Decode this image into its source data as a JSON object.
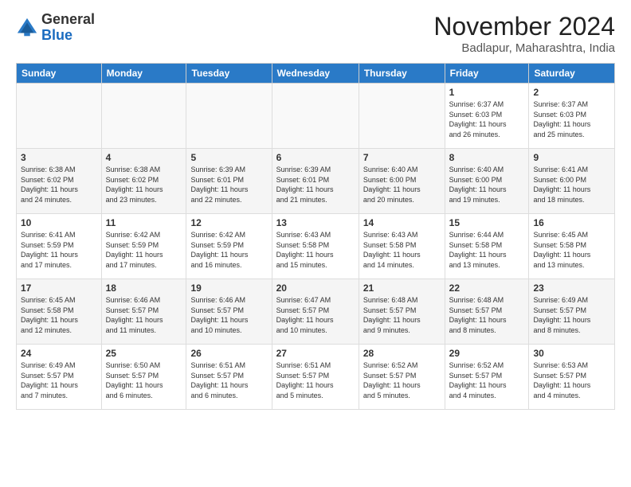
{
  "logo": {
    "general": "General",
    "blue": "Blue"
  },
  "header": {
    "month": "November 2024",
    "location": "Badlapur, Maharashtra, India"
  },
  "weekdays": [
    "Sunday",
    "Monday",
    "Tuesday",
    "Wednesday",
    "Thursday",
    "Friday",
    "Saturday"
  ],
  "weeks": [
    [
      {
        "day": "",
        "info": ""
      },
      {
        "day": "",
        "info": ""
      },
      {
        "day": "",
        "info": ""
      },
      {
        "day": "",
        "info": ""
      },
      {
        "day": "",
        "info": ""
      },
      {
        "day": "1",
        "info": "Sunrise: 6:37 AM\nSunset: 6:03 PM\nDaylight: 11 hours\nand 26 minutes."
      },
      {
        "day": "2",
        "info": "Sunrise: 6:37 AM\nSunset: 6:03 PM\nDaylight: 11 hours\nand 25 minutes."
      }
    ],
    [
      {
        "day": "3",
        "info": "Sunrise: 6:38 AM\nSunset: 6:02 PM\nDaylight: 11 hours\nand 24 minutes."
      },
      {
        "day": "4",
        "info": "Sunrise: 6:38 AM\nSunset: 6:02 PM\nDaylight: 11 hours\nand 23 minutes."
      },
      {
        "day": "5",
        "info": "Sunrise: 6:39 AM\nSunset: 6:01 PM\nDaylight: 11 hours\nand 22 minutes."
      },
      {
        "day": "6",
        "info": "Sunrise: 6:39 AM\nSunset: 6:01 PM\nDaylight: 11 hours\nand 21 minutes."
      },
      {
        "day": "7",
        "info": "Sunrise: 6:40 AM\nSunset: 6:00 PM\nDaylight: 11 hours\nand 20 minutes."
      },
      {
        "day": "8",
        "info": "Sunrise: 6:40 AM\nSunset: 6:00 PM\nDaylight: 11 hours\nand 19 minutes."
      },
      {
        "day": "9",
        "info": "Sunrise: 6:41 AM\nSunset: 6:00 PM\nDaylight: 11 hours\nand 18 minutes."
      }
    ],
    [
      {
        "day": "10",
        "info": "Sunrise: 6:41 AM\nSunset: 5:59 PM\nDaylight: 11 hours\nand 17 minutes."
      },
      {
        "day": "11",
        "info": "Sunrise: 6:42 AM\nSunset: 5:59 PM\nDaylight: 11 hours\nand 17 minutes."
      },
      {
        "day": "12",
        "info": "Sunrise: 6:42 AM\nSunset: 5:59 PM\nDaylight: 11 hours\nand 16 minutes."
      },
      {
        "day": "13",
        "info": "Sunrise: 6:43 AM\nSunset: 5:58 PM\nDaylight: 11 hours\nand 15 minutes."
      },
      {
        "day": "14",
        "info": "Sunrise: 6:43 AM\nSunset: 5:58 PM\nDaylight: 11 hours\nand 14 minutes."
      },
      {
        "day": "15",
        "info": "Sunrise: 6:44 AM\nSunset: 5:58 PM\nDaylight: 11 hours\nand 13 minutes."
      },
      {
        "day": "16",
        "info": "Sunrise: 6:45 AM\nSunset: 5:58 PM\nDaylight: 11 hours\nand 13 minutes."
      }
    ],
    [
      {
        "day": "17",
        "info": "Sunrise: 6:45 AM\nSunset: 5:58 PM\nDaylight: 11 hours\nand 12 minutes."
      },
      {
        "day": "18",
        "info": "Sunrise: 6:46 AM\nSunset: 5:57 PM\nDaylight: 11 hours\nand 11 minutes."
      },
      {
        "day": "19",
        "info": "Sunrise: 6:46 AM\nSunset: 5:57 PM\nDaylight: 11 hours\nand 10 minutes."
      },
      {
        "day": "20",
        "info": "Sunrise: 6:47 AM\nSunset: 5:57 PM\nDaylight: 11 hours\nand 10 minutes."
      },
      {
        "day": "21",
        "info": "Sunrise: 6:48 AM\nSunset: 5:57 PM\nDaylight: 11 hours\nand 9 minutes."
      },
      {
        "day": "22",
        "info": "Sunrise: 6:48 AM\nSunset: 5:57 PM\nDaylight: 11 hours\nand 8 minutes."
      },
      {
        "day": "23",
        "info": "Sunrise: 6:49 AM\nSunset: 5:57 PM\nDaylight: 11 hours\nand 8 minutes."
      }
    ],
    [
      {
        "day": "24",
        "info": "Sunrise: 6:49 AM\nSunset: 5:57 PM\nDaylight: 11 hours\nand 7 minutes."
      },
      {
        "day": "25",
        "info": "Sunrise: 6:50 AM\nSunset: 5:57 PM\nDaylight: 11 hours\nand 6 minutes."
      },
      {
        "day": "26",
        "info": "Sunrise: 6:51 AM\nSunset: 5:57 PM\nDaylight: 11 hours\nand 6 minutes."
      },
      {
        "day": "27",
        "info": "Sunrise: 6:51 AM\nSunset: 5:57 PM\nDaylight: 11 hours\nand 5 minutes."
      },
      {
        "day": "28",
        "info": "Sunrise: 6:52 AM\nSunset: 5:57 PM\nDaylight: 11 hours\nand 5 minutes."
      },
      {
        "day": "29",
        "info": "Sunrise: 6:52 AM\nSunset: 5:57 PM\nDaylight: 11 hours\nand 4 minutes."
      },
      {
        "day": "30",
        "info": "Sunrise: 6:53 AM\nSunset: 5:57 PM\nDaylight: 11 hours\nand 4 minutes."
      }
    ]
  ]
}
